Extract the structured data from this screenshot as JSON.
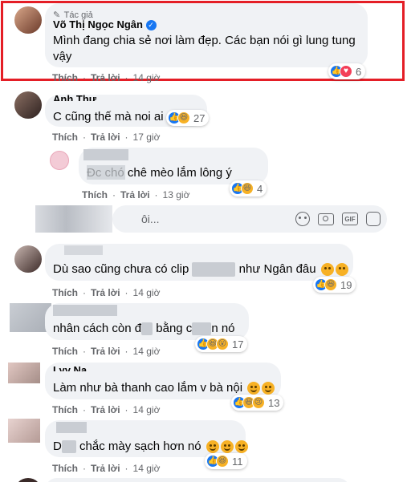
{
  "author_comment": {
    "badge": "Tác giả",
    "name": "Võ Thị Ngọc Ngân",
    "text": "Mình đang chia sẻ nơi làm đẹp. Các bạn nói gì lung tung vậy",
    "like_label": "Thích",
    "reply_label": "Trả lời",
    "time": "14 giờ",
    "reaction_count": "6"
  },
  "comments": [
    {
      "name": "Anh Thư",
      "text": "C cũng thế mà noi ai",
      "like_label": "Thích",
      "reply_label": "Trả lời",
      "time": "17 giờ",
      "reaction_count": "27"
    },
    {
      "name": "",
      "text": "Đc chó chê mèo lắm lông ý",
      "like_label": "Thích",
      "reply_label": "Trả lời",
      "time": "13 giờ",
      "reaction_count": "4"
    },
    {
      "name": "",
      "text_a": "Dù sao cũng chưa có clip",
      "text_b": "như Ngân đâu",
      "like_label": "Thích",
      "reply_label": "Trả lời",
      "time": "14 giờ",
      "reaction_count": "19"
    },
    {
      "name": "",
      "text_a": "nhân cách còn đ",
      "text_b": "bằng c",
      "text_c": "n nó",
      "like_label": "Thích",
      "reply_label": "Trả lời",
      "time": "14 giờ",
      "reaction_count": "17"
    },
    {
      "name": "Lyy Na",
      "text": "Làm như bà thanh cao lắm v bà nội",
      "like_label": "Thích",
      "reply_label": "Trả lời",
      "time": "14 giờ",
      "reaction_count": "13"
    },
    {
      "name": "",
      "text_a": "D",
      "text_b": "chắc mày sạch hơn nó",
      "like_label": "Thích",
      "reply_label": "Trả lời",
      "time": "14 giờ",
      "reaction_count": "11"
    }
  ],
  "reply_input": {
    "placeholder": "ôi..."
  },
  "colors": {
    "highlight": "#e41e26",
    "like": "#1877f2",
    "heart": "#f33e58",
    "haha": "#f7b125"
  },
  "icons": [
    "pencil-icon",
    "verified-icon",
    "emoji-icon",
    "camera-icon",
    "gif-icon",
    "sticker-icon"
  ]
}
